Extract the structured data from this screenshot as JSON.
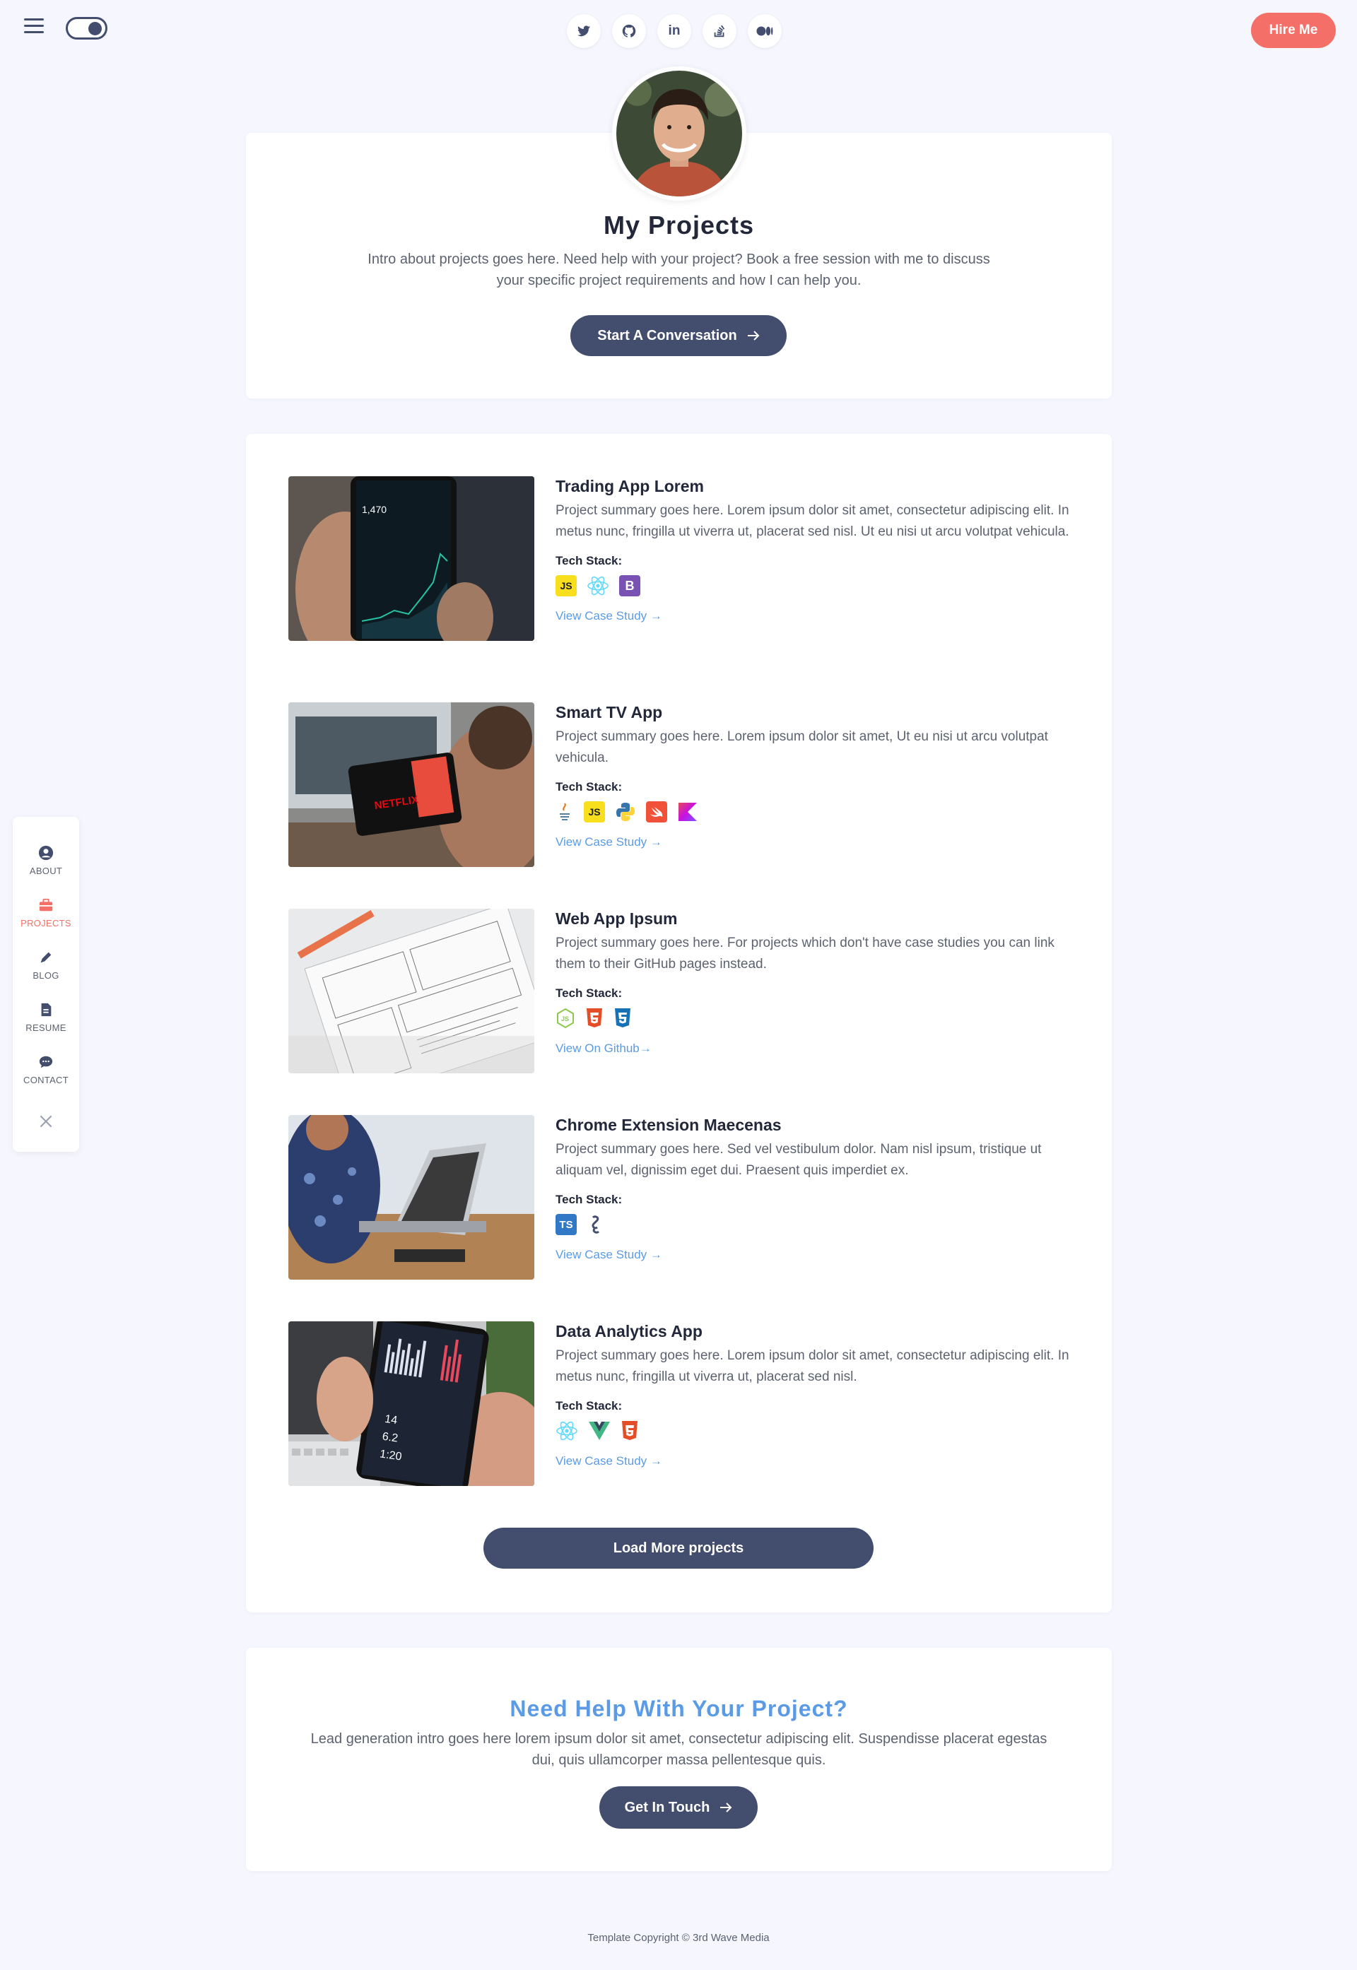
{
  "header": {
    "hire_label": "Hire Me",
    "social": [
      {
        "name": "twitter-icon",
        "glyph": "🐦"
      },
      {
        "name": "github-icon",
        "glyph": "◎"
      },
      {
        "name": "linkedin-icon",
        "glyph": "in"
      },
      {
        "name": "stack-overflow-icon",
        "glyph": "≋"
      },
      {
        "name": "medium-icon",
        "glyph": "●▌"
      }
    ]
  },
  "sidenav": {
    "items": [
      {
        "label": "ABOUT",
        "icon": "user-icon"
      },
      {
        "label": "PROJECTS",
        "icon": "briefcase-icon",
        "active": true
      },
      {
        "label": "BLOG",
        "icon": "pen-icon"
      },
      {
        "label": "RESUME",
        "icon": "file-icon"
      },
      {
        "label": "CONTACT",
        "icon": "chat-icon"
      }
    ]
  },
  "intro": {
    "title": "My Projects",
    "text": "Intro about projects goes here. Need help with your project? Book a free session with me to discuss your specific project requirements and how I can help you.",
    "button": "Start A Conversation"
  },
  "projects": [
    {
      "title": "Trading App Lorem",
      "summary": "Project summary goes here. Lorem ipsum dolor sit amet, consectetur adipiscing elit. In metus nunc, fringilla ut viverra ut, placerat sed nisl. Ut eu nisi ut arcu volutpat vehicula.",
      "tech_label": "Tech Stack:",
      "stack": [
        "JS",
        "React",
        "B"
      ],
      "link": "View Case Study →"
    },
    {
      "title": "Smart TV App",
      "summary": "Project summary goes here. Lorem ipsum dolor sit amet, Ut eu nisi ut arcu volutpat vehicula.",
      "tech_label": "Tech Stack:",
      "stack": [
        "Java",
        "JS",
        "Python",
        "Swift",
        "Kotlin"
      ],
      "link": "View Case Study →"
    },
    {
      "title": "Web App Ipsum",
      "summary": "Project summary goes here. For projects which don't have case studies you can link them to their GitHub pages instead.",
      "tech_label": "Tech Stack:",
      "stack": [
        "Node",
        "HTML5",
        "CSS3"
      ],
      "link": "View On Github→"
    },
    {
      "title": "Chrome Extension Maecenas",
      "summary": "Project summary goes here. Sed vel vestibulum dolor. Nam nisl ipsum, tristique ut aliquam vel, dignissim eget dui. Praesent quis imperdiet ex.",
      "tech_label": "Tech Stack:",
      "stack": [
        "TS",
        "Webpack"
      ],
      "link": "View Case Study →"
    },
    {
      "title": "Data Analytics App",
      "summary": "Project summary goes here. Lorem ipsum dolor sit amet, consectetur adipiscing elit. In metus nunc, fringilla ut viverra ut, placerat sed nisl.",
      "tech_label": "Tech Stack:",
      "stack": [
        "React",
        "Vue",
        "HTML5"
      ],
      "link": "View Case Study →"
    }
  ],
  "load_more": "Load More projects",
  "cta": {
    "title": "Need Help With Your Project?",
    "text": "Lead generation intro goes here lorem ipsum dolor sit amet, consectetur adipiscing elit. Suspendisse placerat egestas dui, quis ullamcorper massa pellentesque quis.",
    "button": "Get In Touch"
  },
  "footer": "Template Copyright © 3rd Wave Media",
  "colors": {
    "accent": "#f46f67",
    "primary": "#434e6e",
    "link": "#5b9be6",
    "bg": "#f5f6fe"
  }
}
